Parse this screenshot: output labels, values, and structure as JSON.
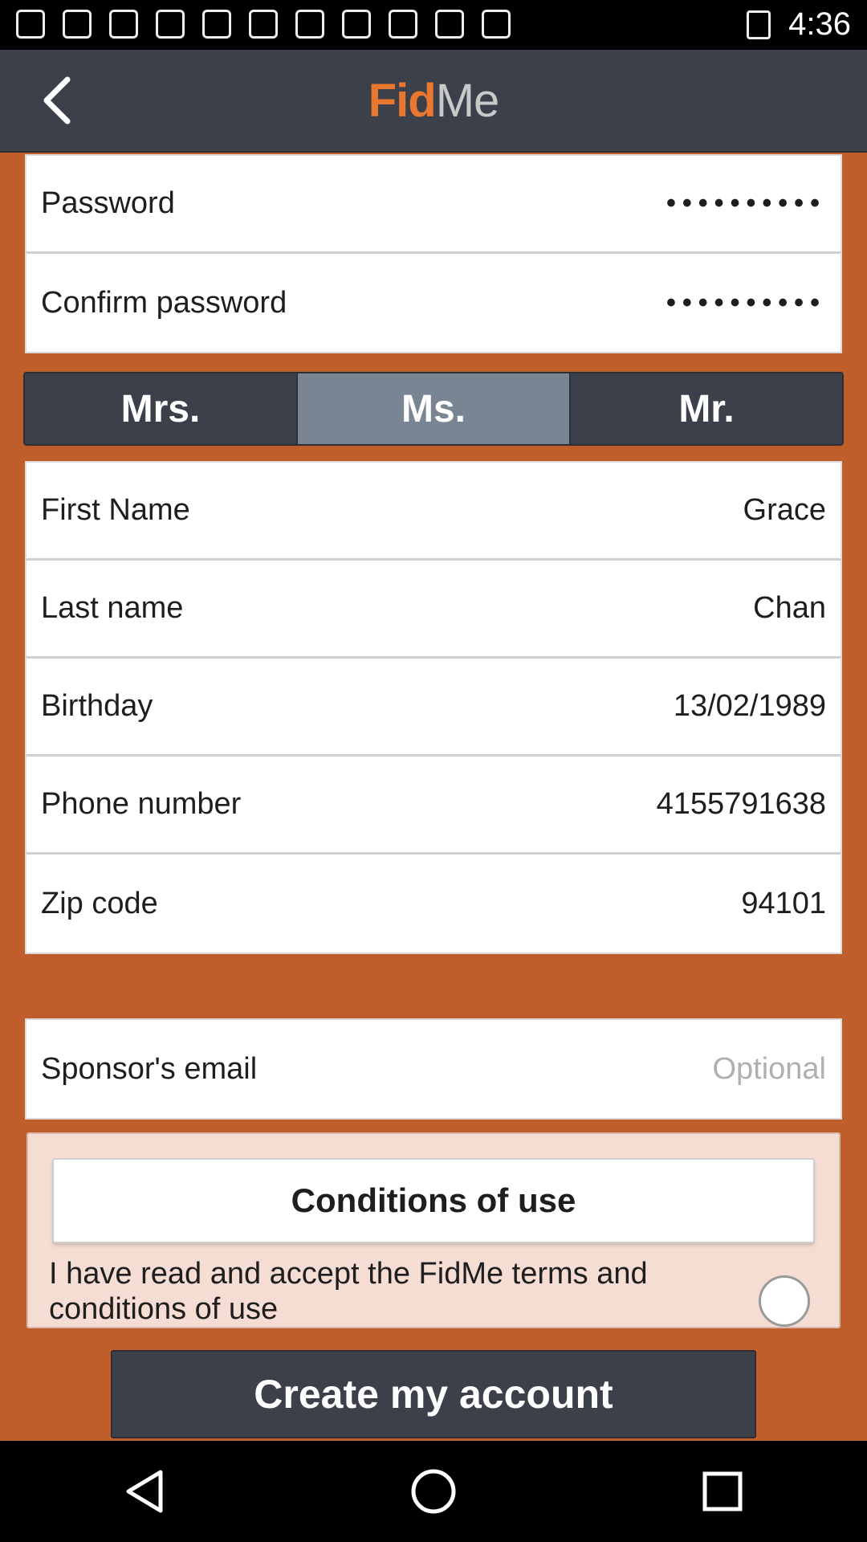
{
  "status_bar": {
    "time": "4:36"
  },
  "header": {
    "logo_part1": "Fid",
    "logo_part2": "Me"
  },
  "password_fields": [
    {
      "label": "Password",
      "value": "••••••••••"
    },
    {
      "label": "Confirm password",
      "value": "••••••••••"
    }
  ],
  "title_options": {
    "options": [
      "Mrs.",
      "Ms.",
      "Mr."
    ],
    "selected": "Ms."
  },
  "profile_fields": [
    {
      "label": "First Name",
      "value": "Grace"
    },
    {
      "label": "Last name",
      "value": "Chan"
    },
    {
      "label": "Birthday",
      "value": "13/02/1989"
    },
    {
      "label": "Phone number",
      "value": "4155791638"
    },
    {
      "label": "Zip code",
      "value": "94101"
    }
  ],
  "sponsor": {
    "label": "Sponsor's email",
    "placeholder": "Optional"
  },
  "conditions": {
    "button_label": "Conditions of use",
    "accept_text": "I have read and accept the FidMe terms and conditions of use",
    "accepted": false
  },
  "submit": {
    "label": "Create my account"
  },
  "colors": {
    "background": "#c05e2b",
    "header": "#3c404a",
    "accent": "#e9772e",
    "selected_segment": "#7a8594"
  }
}
